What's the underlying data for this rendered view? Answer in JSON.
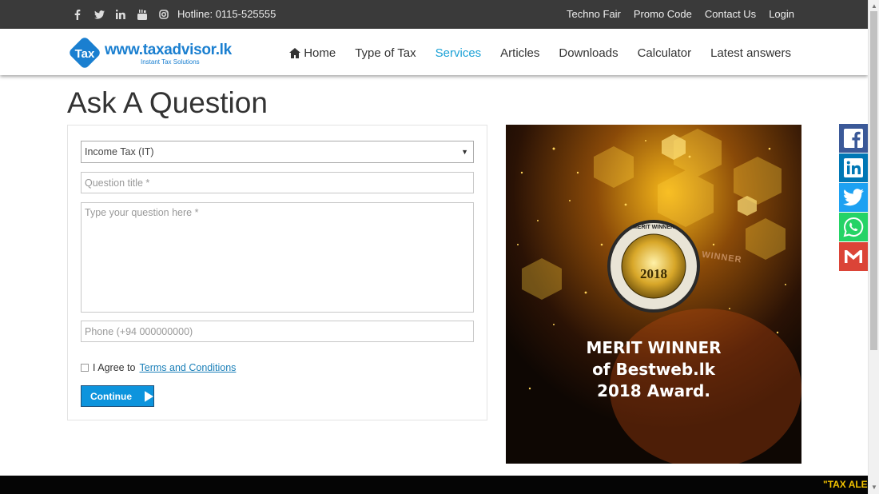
{
  "topbar": {
    "social_icons": [
      "facebook-icon",
      "twitter-icon",
      "linkedin-icon",
      "youtube-icon",
      "instagram-icon"
    ],
    "hotline": "Hotline: 0115-525555",
    "links": [
      "Techno Fair",
      "Promo Code",
      "Contact Us",
      "Login"
    ]
  },
  "header": {
    "logo_badge": "Tax",
    "logo_text": "www.taxadvisor.lk",
    "logo_tagline": "Instant Tax Solutions",
    "nav": [
      {
        "label": "Home",
        "icon": "home-icon"
      },
      {
        "label": "Type of Tax"
      },
      {
        "label": "Services",
        "active": true
      },
      {
        "label": "Articles"
      },
      {
        "label": "Downloads"
      },
      {
        "label": "Calculator"
      },
      {
        "label": "Latest answers"
      }
    ]
  },
  "page": {
    "title": "Ask A Question"
  },
  "form": {
    "tax_type_selected": "Income Tax (IT)",
    "question_title_placeholder": "Question title *",
    "question_body_placeholder": "Type your question here *",
    "phone_placeholder": "Phone (+94 000000000)",
    "agree_text": "I Agree to",
    "terms_link": "Terms and Conditions",
    "continue_label": "Continue"
  },
  "award": {
    "seal_top": "MERIT WINNER",
    "seal_year": "2018",
    "ribbon_text": "WINNER",
    "line1": "MERIT WINNER",
    "line2": "of Bestweb.lk",
    "line3": "2018 Award."
  },
  "share_bar": [
    "facebook-icon",
    "linkedin-icon",
    "twitter-icon",
    "whatsapp-icon",
    "gmail-icon"
  ],
  "colors": {
    "topbar": "#3a3a3a",
    "accent": "#1ba1d6",
    "button": "#0d94dd",
    "facebook": "#3b5998",
    "linkedin": "#0077b5",
    "twitter": "#1da1f2",
    "whatsapp": "#25d366",
    "gmail": "#db4437",
    "ticker_text": "#f2c200"
  },
  "ticker": {
    "text": "\"TAX ALER"
  }
}
